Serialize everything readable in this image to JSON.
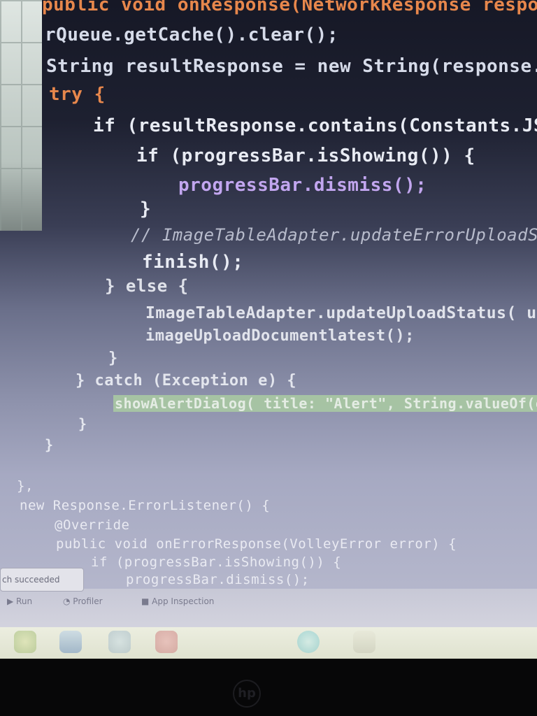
{
  "code_lines": [
    "public void onResponse(NetworkResponse response) {",
    "rQueue.getCache().clear();",
    "String resultResponse = new String(response.dat",
    "try {",
    "if (resultResponse.contains(Constants.JSON_",
    "if (progressBar.isShowing()) {",
    "progressBar.dismiss();",
    "}",
    "// ImageTableAdapter.updateErrorUploadStat",
    "finish();",
    "} else {",
    "ImageTableAdapter.updateUploadStatus( uploa",
    "imageUploadDocumentlatest();",
    "}",
    "} catch (Exception e) {",
    "showAlertDialog( title: \"Alert\", String.valueOf(e),",
    "}",
    "}",
    "},",
    "new Response.ErrorListener() {",
    "@Override",
    "public void onErrorResponse(VolleyError error) {",
    "if (progressBar.isShowing()) {",
    "progressBar.dismiss();"
  ],
  "toast": {
    "text": "ch succeeded"
  },
  "tool_tabs": {
    "run": "Run",
    "profiler": "Profiler",
    "app_inspection": "App Inspection"
  },
  "taskbar": {
    "icons": [
      "chrome-icon",
      "folder-icon",
      "media-icon",
      "paint-icon",
      "edge-icon",
      "app-icon"
    ]
  },
  "brand": {
    "logo_text": "hp"
  }
}
